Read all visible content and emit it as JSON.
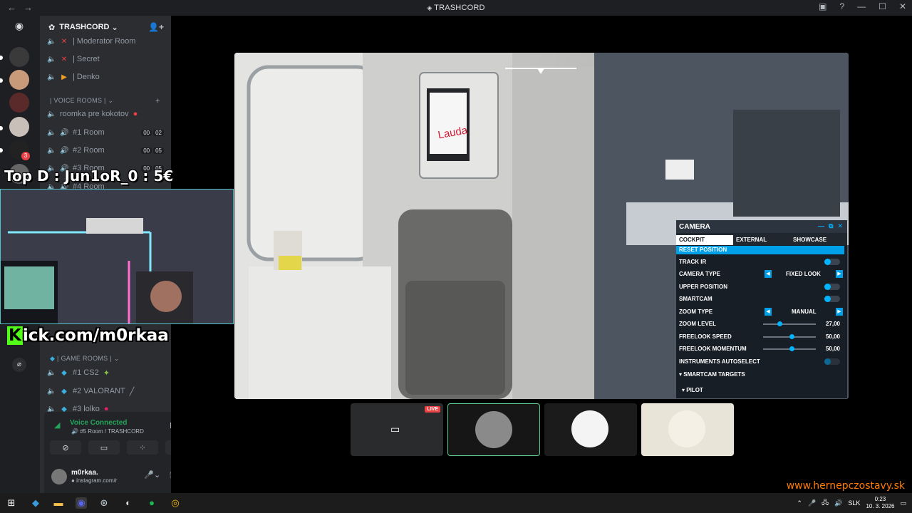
{
  "window": {
    "title": "TRASHCORD",
    "nav_back": "←",
    "nav_forward": "→"
  },
  "guild": {
    "name": "TRASHCORD",
    "channels": [
      {
        "label": "| Moderator Room",
        "icon": "✕"
      },
      {
        "label": "| Secret",
        "icon": "✕"
      },
      {
        "label": "| Denko",
        "icon": "▶"
      }
    ],
    "voice_category": "| VOICE ROOMS |",
    "voice_rooms": [
      {
        "label": "roomka pre kokotov",
        "badge": []
      },
      {
        "label": "#1 Room",
        "badge": [
          "00",
          "02"
        ]
      },
      {
        "label": "#2 Room",
        "badge": [
          "00",
          "05"
        ]
      },
      {
        "label": "#3 Room",
        "badge": [
          "00",
          "05"
        ]
      },
      {
        "label": "#4 Room",
        "badge": []
      }
    ],
    "game_category": "| GAME ROOMS |",
    "game_rooms": [
      {
        "label": "#1 CS2"
      },
      {
        "label": "#2 VALORANT"
      },
      {
        "label": "#3 lolko"
      }
    ]
  },
  "server_badge": "3",
  "overlay": {
    "top_donor": "Top D : Jun1oR_0 : 5€",
    "kick_k": "K",
    "kick_rest": "ick.com/m0rkaa"
  },
  "voice": {
    "status": "Voice Connected",
    "room": "#5 Room / TRASHCORD"
  },
  "user": {
    "name": "m0rkaa.",
    "status": "instagram.com/r"
  },
  "game": {
    "screen_brand": "Lauda"
  },
  "camera_panel": {
    "title": "CAMERA",
    "tabs": [
      "COCKPIT",
      "EXTERNAL",
      "SHOWCASE"
    ],
    "reset": "RESET POSITION",
    "rows": {
      "track_ir": "TRACK IR",
      "camera_type": "CAMERA TYPE",
      "camera_type_value": "FIXED LOOK",
      "upper_position": "UPPER POSITION",
      "smartcam": "SMARTCAM",
      "zoom_type": "ZOOM TYPE",
      "zoom_type_value": "MANUAL",
      "zoom_level": "ZOOM LEVEL",
      "zoom_level_value": "27,00",
      "freelook_speed": "FREELOOK SPEED",
      "freelook_speed_value": "50,00",
      "freelook_momentum": "FREELOOK MOMENTUM",
      "freelook_momentum_value": "50,00",
      "instruments": "INSTRUMENTS AUTOSELECT",
      "smartcam_targets": "SMARTCAM TARGETS",
      "pilot": "PILOT"
    },
    "slider_levels": {
      "zoom_level": 0.27,
      "freelook_speed": 0.5,
      "freelook_momentum": 0.5
    }
  },
  "thumbs": {
    "live_label": "LIVE"
  },
  "taskbar": {
    "lang": "SLK",
    "time": "0:23",
    "date": "10. 3. 2026"
  },
  "watermark": "www.hernepczostavy.sk",
  "colors": {
    "accent": "#00a0e9",
    "voice_green": "#23a559",
    "live_red": "#ed4245",
    "kick_green": "#53fc18",
    "watermark": "#ff7a00"
  }
}
